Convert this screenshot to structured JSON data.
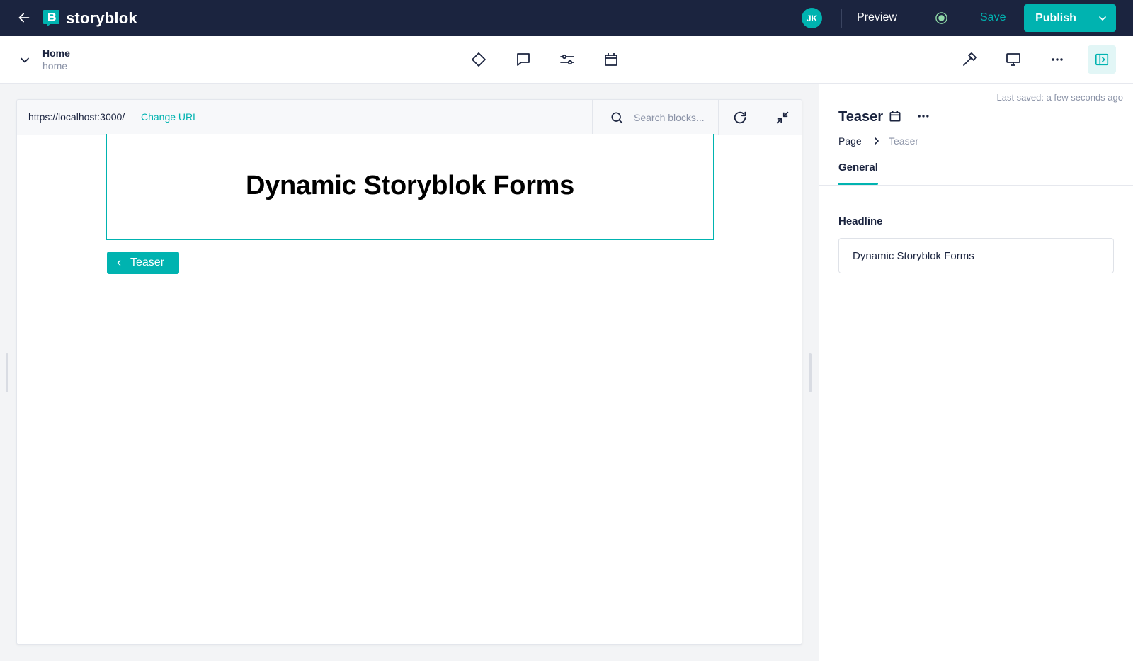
{
  "topbar": {
    "logo_text": "storyblok",
    "logo_letter": "B",
    "avatar_initials": "JK",
    "preview_label": "Preview",
    "save_label": "Save",
    "publish_label": "Publish"
  },
  "story": {
    "name": "Home",
    "slug": "home"
  },
  "preview": {
    "url": "https://localhost:3000/",
    "change_url_label": "Change URL",
    "search_placeholder": "Search blocks...",
    "headline": "Dynamic Storyblok Forms",
    "block_tag": "Teaser"
  },
  "sidebar": {
    "last_saved": "Last saved: a few seconds ago",
    "block_title": "Teaser",
    "breadcrumb": [
      "Page",
      "Teaser"
    ],
    "tabs": [
      {
        "label": "General",
        "active": true
      }
    ],
    "fields": [
      {
        "label": "Headline",
        "value": "Dynamic Storyblok Forms"
      }
    ]
  },
  "colors": {
    "accent": "#00b3b0",
    "topbar_bg": "#1b243f",
    "text_primary": "#1b243f",
    "text_muted": "#8b93a7"
  },
  "icons": {
    "back": "arrow-left-icon",
    "center_tools": [
      "diamond-icon",
      "comment-icon",
      "sliders-icon",
      "calendar-icon"
    ],
    "right_tools": [
      "hammer-icon",
      "monitor-icon",
      "more-horizontal-icon",
      "sidebar-toggle-icon"
    ]
  }
}
